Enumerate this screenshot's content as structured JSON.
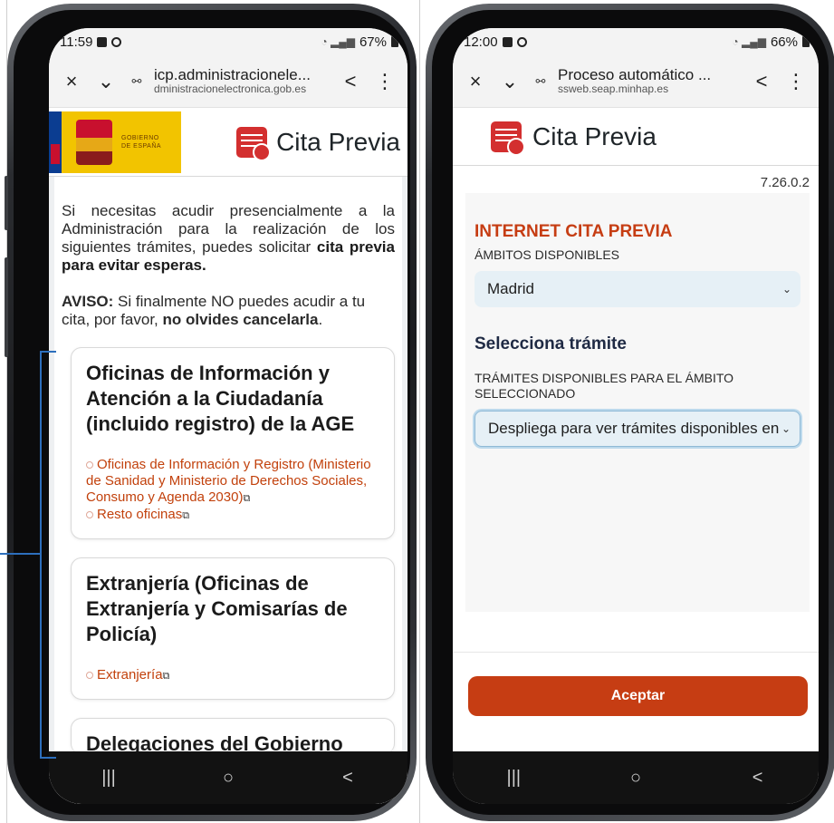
{
  "left": {
    "status": {
      "time": "11:59",
      "battery": "67%"
    },
    "urlbar": {
      "title": "icp.administracionele...",
      "domain": "dministracionelectronica.gob.es"
    },
    "gov_logo": {
      "text": "GOBIERNO DE ESPAÑA"
    },
    "brand": "Cita Previa",
    "intro_text": "Si necesitas acudir presencialmente a la Administración para la realización de los siguientes trámites, puedes solicitar ",
    "intro_bold": "cita previa para evitar esperas.",
    "aviso_label": "AVISO:",
    "aviso_text": " Si finalmente NO puedes acudir a tu cita, por favor, ",
    "aviso_bold": "no olvides cancelarla",
    "aviso_end": ".",
    "cards": [
      {
        "title": "Oficinas de Información y Atención a la Ciudadanía (incluido registro) de la AGE",
        "links": [
          "Oficinas de Información y Registro (Ministerio de Sanidad y Ministerio de Derechos Sociales, Consumo y Agenda 2030)",
          "Resto oficinas"
        ]
      },
      {
        "title": "Extranjería (Oficinas de Extranjería y Comisarías de Policía)",
        "links": [
          "Extranjería"
        ]
      }
    ],
    "card3_title": "Delegaciones del Gobierno"
  },
  "right": {
    "status": {
      "time": "12:00",
      "battery": "66%"
    },
    "urlbar": {
      "title": "Proceso automático ...",
      "domain": "ssweb.seap.minhap.es"
    },
    "brand": "Cita Previa",
    "version": "7.26.0.2",
    "form_title": "INTERNET CITA PREVIA",
    "ambitos_label": "ÁMBITOS DISPONIBLES",
    "ambito_selected": "Madrid",
    "subhead": "Selecciona trámite",
    "tramites_label": "TRÁMITES DISPONIBLES PARA EL ÁMBITO SELECCIONADO",
    "tramite_selected": "Despliega para ver trámites disponibles en esta provincia",
    "accept_label": "Aceptar"
  },
  "icons": {
    "close": "×",
    "chevron": "⌄",
    "share": "<",
    "more": "⋮",
    "site": "⚯",
    "recent": "|||",
    "home": "○",
    "back": "<"
  },
  "colors": {
    "accent": "#c63d13",
    "link": "#c2410c",
    "select_bg": "#e6f0f6",
    "bracket": "#2d6fbd"
  }
}
